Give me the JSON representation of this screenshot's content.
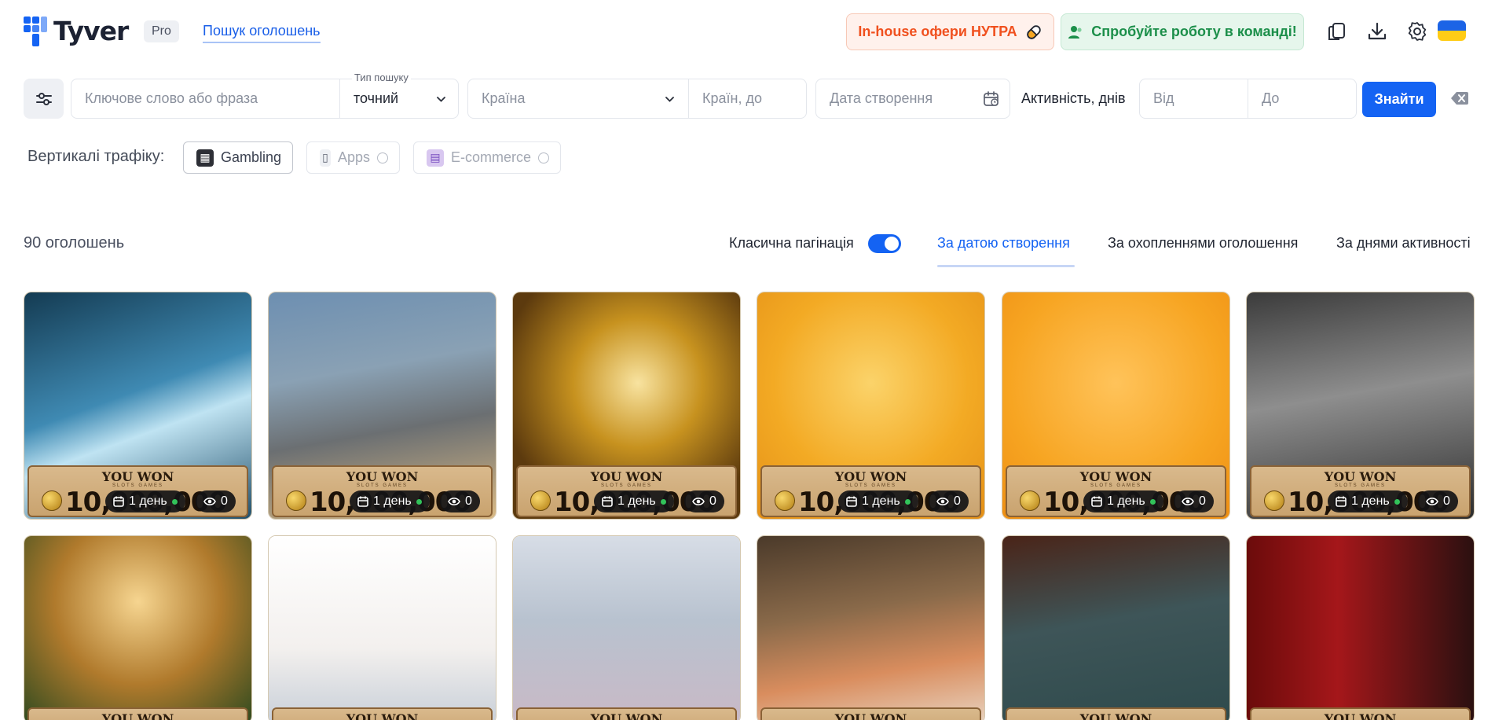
{
  "app": {
    "brand": "Tyver",
    "plan_badge": "Pro",
    "nav_link": "Пошук оголошень"
  },
  "header": {
    "nutra_button": "In-house офери НУТРА",
    "team_button": "Спробуйте роботу в команді!",
    "icons": [
      "copy-icon",
      "download-icon",
      "settings-icon",
      "ukraine-flag-icon"
    ],
    "colors": {
      "accent": "#1463f3",
      "nutra": "#f0501e",
      "team": "#1c8f4a"
    }
  },
  "search": {
    "keyword_placeholder": "Ключове слово або фраза",
    "search_type_label": "Тип пошуку",
    "search_type_value": "точний",
    "country_placeholder": "Країна",
    "countries_to_placeholder": "Країн, до",
    "created_date_placeholder": "Дата створення",
    "activity_label": "Активність, днів",
    "activity_from_placeholder": "Від",
    "activity_to_placeholder": "До",
    "find_button": "Знайти"
  },
  "verticals": {
    "label": "Вертикалі трафіку:",
    "items": [
      {
        "label": "Gambling",
        "selected": true
      },
      {
        "label": "Apps",
        "selected": false
      },
      {
        "label": "E-commerce",
        "selected": false
      }
    ]
  },
  "results": {
    "count_text": "90 оголошень",
    "pagination_label": "Класична пагінація",
    "pagination_enabled": true,
    "sort_options": [
      {
        "label": "За датою створення",
        "active": true
      },
      {
        "label": "За охопленнями оголошення",
        "active": false
      },
      {
        "label": "За днями активності",
        "active": false
      }
    ]
  },
  "cards": {
    "banner_title": "YOU WON",
    "banner_sub": "SLOTS GAMES",
    "banner_amount": "10,000,000",
    "row1": [
      {
        "days": "1 день",
        "views": "0"
      },
      {
        "days": "1 день",
        "views": "0"
      },
      {
        "days": "1 день",
        "views": "0"
      },
      {
        "days": "1 день",
        "views": "0"
      },
      {
        "days": "1 день",
        "views": "0"
      },
      {
        "days": "1 день",
        "views": "0"
      }
    ]
  }
}
